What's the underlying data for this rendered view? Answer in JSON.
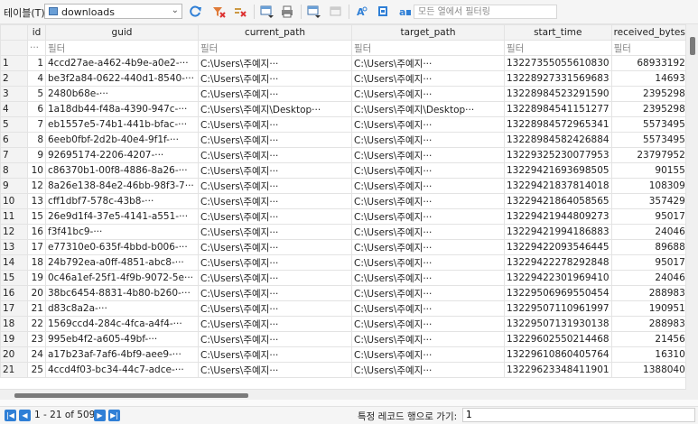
{
  "toolbar": {
    "table_label": "테이블(T):",
    "table_value": "downloads",
    "filter_placeholder": "모든 열에서 필터링",
    "icons": [
      "refresh-icon",
      "clear-filters-icon",
      "clear-sort-icon",
      "insert-record-icon",
      "print-icon",
      "save-table-icon",
      "delete-record-icon",
      "find-icon",
      "find-replace-icon",
      "conditional-format-icon"
    ]
  },
  "grid": {
    "columns": [
      "id",
      "guid",
      "current_path",
      "target_path",
      "start_time",
      "received_bytes"
    ],
    "filter_placeholder": "필터",
    "corner_filter": "···",
    "rows": [
      [
        "1",
        "1",
        "4ccd27ae-a462-4b9e-a0e2-···",
        "C:\\Users\\주예지···",
        "C:\\Users\\주예지···",
        "13227355055610830",
        "68933192"
      ],
      [
        "2",
        "4",
        "be3f2a84-0622-440d1-8540-···",
        "C:\\Users\\주예지···",
        "C:\\Users\\주예지···",
        "13228927331569683",
        "14693"
      ],
      [
        "3",
        "5",
        "2480b68e-···",
        "C:\\Users\\주예지···",
        "C:\\Users\\주예지···",
        "13228984523291590",
        "2395298"
      ],
      [
        "4",
        "6",
        "1a18db44-f48a-4390-947c-···",
        "C:\\Users\\주예지\\Desktop···",
        "C:\\Users\\주예지\\Desktop···",
        "13228984541151277",
        "2395298"
      ],
      [
        "5",
        "7",
        "eb1557e5-74b1-441b-bfac-···",
        "C:\\Users\\주예지···",
        "C:\\Users\\주예지···",
        "13228984572965341",
        "5573495"
      ],
      [
        "6",
        "8",
        "6eeb0fbf-2d2b-40e4-9f1f-···",
        "C:\\Users\\주예지···",
        "C:\\Users\\주예지···",
        "13228984582426884",
        "5573495"
      ],
      [
        "7",
        "9",
        "92695174-2206-4207-···",
        "C:\\Users\\주예지···",
        "C:\\Users\\주예지···",
        "13229325230077953",
        "23797952"
      ],
      [
        "8",
        "10",
        "c86370b1-00f8-4886-8a26-···",
        "C:\\Users\\주예지···",
        "C:\\Users\\주예지···",
        "13229421693698505",
        "90155"
      ],
      [
        "9",
        "12",
        "8a26e138-84e2-46bb-98f3-7···",
        "C:\\Users\\주예지···",
        "C:\\Users\\주예지···",
        "13229421837814018",
        "108309"
      ],
      [
        "10",
        "13",
        "cff1dbf7-578c-43b8-···",
        "C:\\Users\\주예지···",
        "C:\\Users\\주예지···",
        "13229421864058565",
        "357429"
      ],
      [
        "11",
        "15",
        "26e9d1f4-37e5-4141-a551-···",
        "C:\\Users\\주예지···",
        "C:\\Users\\주예지···",
        "13229421944809273",
        "95017"
      ],
      [
        "12",
        "16",
        "f3f41bc9-···",
        "C:\\Users\\주예지···",
        "C:\\Users\\주예지···",
        "13229421994186883",
        "24046"
      ],
      [
        "13",
        "17",
        "e77310e0-635f-4bbd-b006-···",
        "C:\\Users\\주예지···",
        "C:\\Users\\주예지···",
        "13229422093546445",
        "89688"
      ],
      [
        "14",
        "18",
        "24b792ea-a0ff-4851-abc8-···",
        "C:\\Users\\주예지···",
        "C:\\Users\\주예지···",
        "13229422278292848",
        "95017"
      ],
      [
        "15",
        "19",
        "0c46a1ef-25f1-4f9b-9072-5e···",
        "C:\\Users\\주예지···",
        "C:\\Users\\주예지···",
        "13229422301969410",
        "24046"
      ],
      [
        "16",
        "20",
        "38bc6454-8831-4b80-b260-···",
        "C:\\Users\\주예지···",
        "C:\\Users\\주예지···",
        "13229506969550454",
        "288983"
      ],
      [
        "17",
        "21",
        "d83c8a2a-···",
        "C:\\Users\\주예지···",
        "C:\\Users\\주예지···",
        "13229507110961997",
        "190951"
      ],
      [
        "18",
        "22",
        "1569ccd4-284c-4fca-a4f4-···",
        "C:\\Users\\주예지···",
        "C:\\Users\\주예지···",
        "13229507131930138",
        "288983"
      ],
      [
        "19",
        "23",
        "995eb4f2-a605-49bf-···",
        "C:\\Users\\주예지···",
        "C:\\Users\\주예지···",
        "13229602550214468",
        "21456"
      ],
      [
        "20",
        "24",
        "a17b23af-7af6-4bf9-aee9-···",
        "C:\\Users\\주예지···",
        "C:\\Users\\주예지···",
        "13229610860405764",
        "16310"
      ],
      [
        "21",
        "25",
        "4ccd4f03-bc34-44c7-adce-···",
        "C:\\Users\\주예지···",
        "C:\\Users\\주예지···",
        "13229623348411901",
        "1388040"
      ]
    ]
  },
  "status": {
    "range_text": "1 - 21 of 509",
    "goto_label": "특정 레코드 행으로 가기:",
    "goto_value": "1"
  }
}
